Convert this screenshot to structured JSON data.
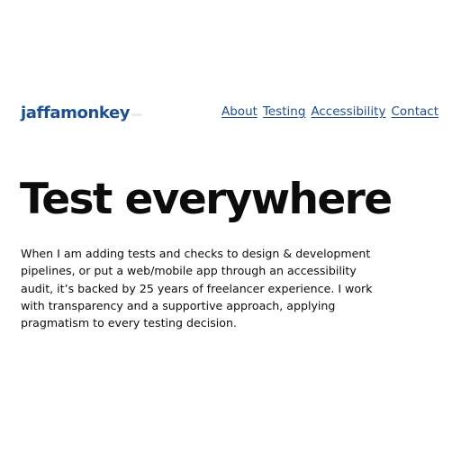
{
  "header": {
    "logo_text": "jaffamonkey",
    "nav": [
      {
        "label": "About"
      },
      {
        "label": "Testing"
      },
      {
        "label": "Accessibility"
      },
      {
        "label": "Contact"
      }
    ]
  },
  "main": {
    "title": "Test everywhere",
    "intro": "When I am adding tests and checks to design & development pipelines, or put a web/mobile app through an accessibility audit, it’s backed by 25 years of freelancer experience. I work with transparency and a supportive approach, applying pragmatism to every testing decision."
  },
  "colors": {
    "link": "#1d4f91",
    "text": "#0b0c0c",
    "background": "#ffffff"
  }
}
